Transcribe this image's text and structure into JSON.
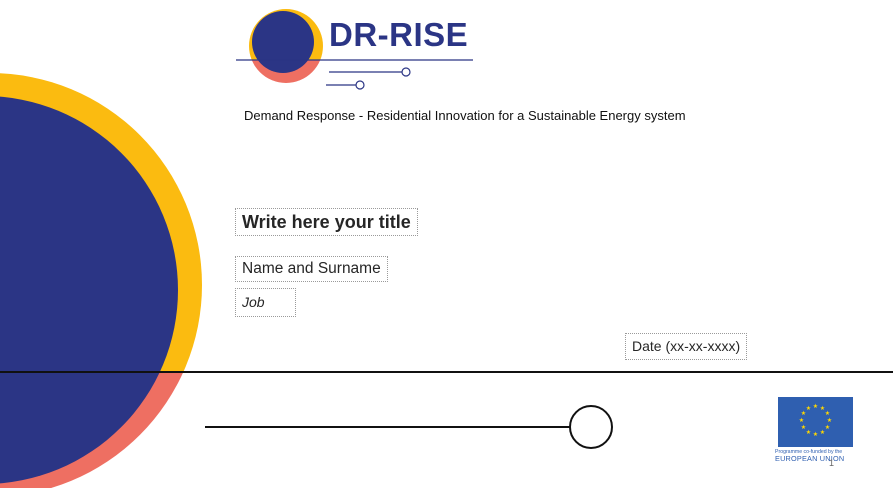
{
  "logo": {
    "text": "DR-RISE"
  },
  "subtitle": "Demand Response - Residential Innovation for a Sustainable Energy system",
  "placeholders": {
    "title": "Write here your title",
    "name": "Name and Surname",
    "job": "Job",
    "date": "Date (xx-xx-xxxx)"
  },
  "eu_logo": {
    "small_text": "Programme co-funded by the",
    "big_text": "EUROPEAN UNION"
  },
  "page_number": "1",
  "colors": {
    "navy": "#2b3585",
    "yellow": "#fbbb10",
    "coral": "#ee6f62",
    "eu_blue": "#2f5fb0"
  }
}
